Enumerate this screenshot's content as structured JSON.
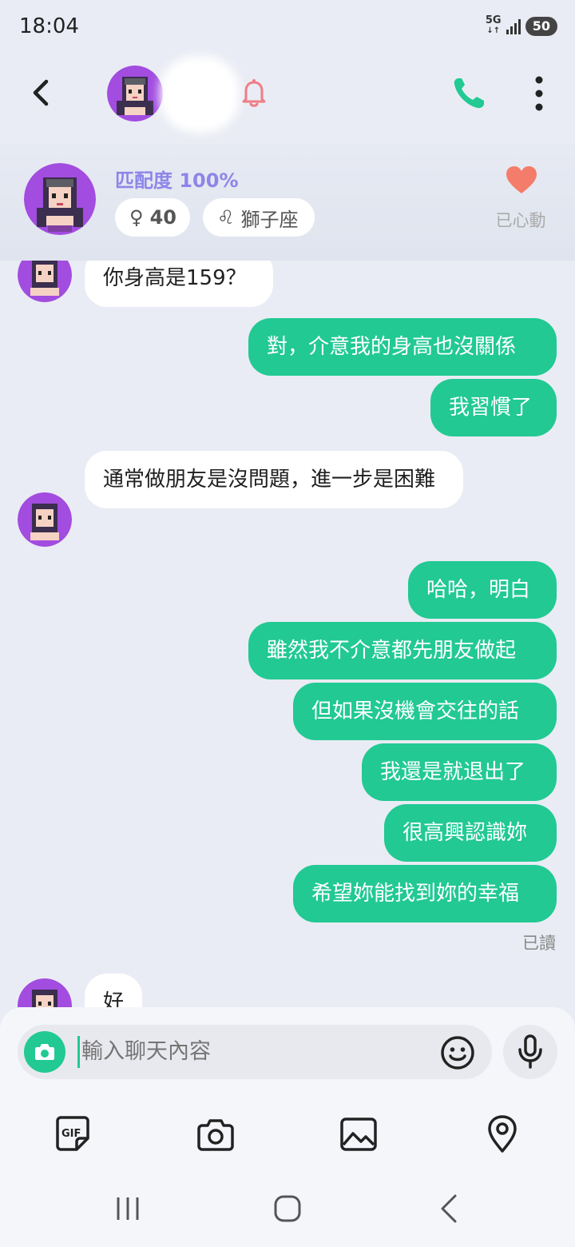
{
  "status_bar": {
    "time": "18:04",
    "network": "5G",
    "battery": "50"
  },
  "header": {
    "contact_name": "",
    "back_icon": "chevron-left-icon",
    "bell_icon": "bell-icon",
    "call_icon": "phone-icon",
    "more_icon": "more-vertical-icon",
    "accent_color": "#22c993"
  },
  "profile": {
    "match_label": "匹配度 100%",
    "gender_symbol": "♀",
    "age": "40",
    "zodiac_symbol": "♌",
    "zodiac": "獅子座",
    "liked_label": "已心動",
    "heart_color": "#f47c6a"
  },
  "messages": [
    {
      "from": "them",
      "text": "你身高是159？"
    },
    {
      "from": "me",
      "text": "對，介意我的身高也沒關係"
    },
    {
      "from": "me",
      "text": "我習慣了"
    },
    {
      "from": "them",
      "text": "通常做朋友是沒問題，進一步是困難"
    },
    {
      "from": "me",
      "text": "哈哈，明白"
    },
    {
      "from": "me",
      "text": "雖然我不介意都先朋友做起"
    },
    {
      "from": "me",
      "text": "但如果沒機會交往的話"
    },
    {
      "from": "me",
      "text": "我還是就退出了"
    },
    {
      "from": "me",
      "text": "很高興認識妳"
    },
    {
      "from": "me",
      "text": "希望妳能找到妳的幸福"
    },
    {
      "from": "them",
      "text": "好"
    }
  ],
  "read_receipt": "已讀",
  "composer": {
    "placeholder": "輸入聊天內容",
    "tools": [
      "gif-icon",
      "camera-icon",
      "image-icon",
      "location-icon"
    ]
  },
  "nav": [
    "recents-icon",
    "home-icon",
    "back-icon"
  ]
}
